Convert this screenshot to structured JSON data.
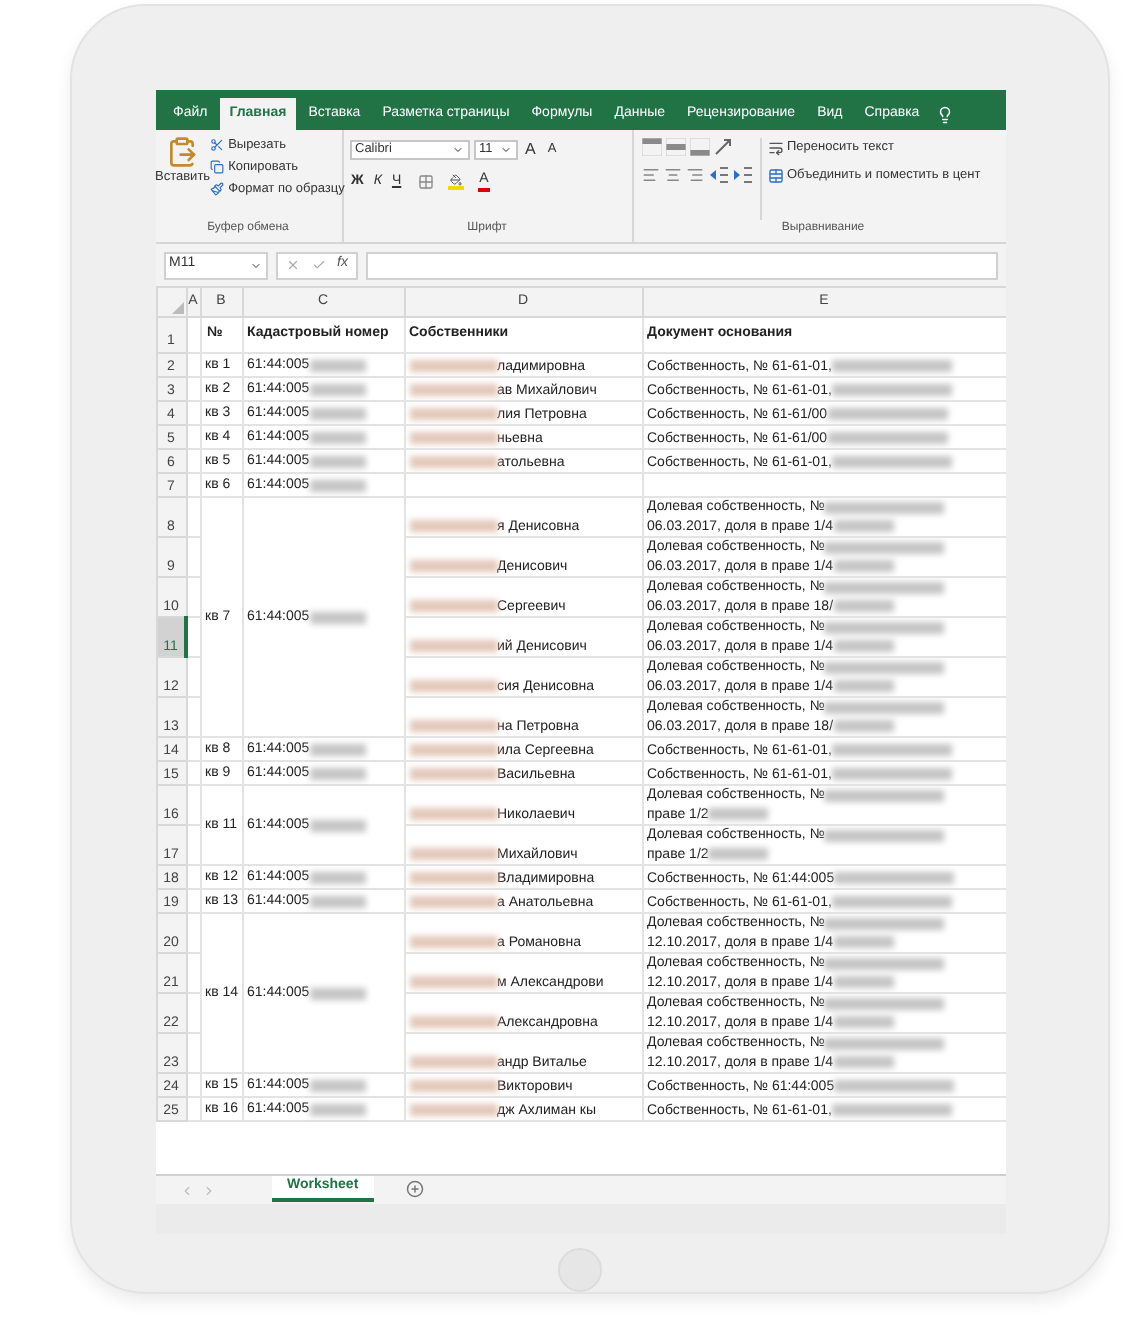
{
  "ribbon_tabs": [
    {
      "label": "Файл",
      "selected": false
    },
    {
      "label": "Главная",
      "selected": true
    },
    {
      "label": "Вставка",
      "selected": false
    },
    {
      "label": "Разметка страницы",
      "selected": false
    },
    {
      "label": "Формулы",
      "selected": false
    },
    {
      "label": "Данные",
      "selected": false
    },
    {
      "label": "Рецензирование",
      "selected": false
    },
    {
      "label": "Вид",
      "selected": false
    },
    {
      "label": "Справка",
      "selected": false
    }
  ],
  "clipboard": {
    "paste": "Вставить",
    "items": [
      {
        "kind": "cut",
        "label": "Вырезать"
      },
      {
        "kind": "copy",
        "label": "Копировать"
      },
      {
        "kind": "format",
        "label": "Формат по образцу"
      }
    ],
    "group_label": "Буфер обмена"
  },
  "font": {
    "family": "Calibri",
    "size": "11",
    "grow": "A",
    "shrink": "A",
    "bold": "Ж",
    "italic": "К",
    "underline": "Ч",
    "color_button": "A",
    "group_label": "Шрифт"
  },
  "alignment": {
    "wrap": "Переносить текст",
    "merge": "Объединить и поместить в цент",
    "group_label": "Выравнивание"
  },
  "formula_bar": {
    "name_box": "M11",
    "fx": "fx"
  },
  "columns": [
    "A",
    "B",
    "C",
    "D",
    "E"
  ],
  "header_row": {
    "row": "1",
    "no": "№",
    "cadastral": "Кадастровый номер",
    "owners": "Собственники",
    "document": "Документ основания"
  },
  "groups": [
    {
      "apt": "кв 1",
      "cadastral": "61:44:005",
      "rows": [
        {
          "row": "2",
          "selected": false,
          "owner": "ладимировна",
          "doc": [
            "Собственность, № 61-61-01,"
          ]
        }
      ]
    },
    {
      "apt": "кв 2",
      "cadastral": "61:44:005",
      "rows": [
        {
          "row": "3",
          "selected": false,
          "owner": "ав Михайлович",
          "doc": [
            "Собственность, № 61-61-01,"
          ]
        }
      ]
    },
    {
      "apt": "кв 3",
      "cadastral": "61:44:005",
      "rows": [
        {
          "row": "4",
          "selected": false,
          "owner": "лия Петровна",
          "doc": [
            "Собственность, № 61-61/00"
          ]
        }
      ]
    },
    {
      "apt": "кв 4",
      "cadastral": "61:44:005",
      "rows": [
        {
          "row": "5",
          "selected": false,
          "owner": "ньевна",
          "doc": [
            "Собственность, № 61-61/00"
          ]
        }
      ]
    },
    {
      "apt": "кв 5",
      "cadastral": "61:44:005",
      "rows": [
        {
          "row": "6",
          "selected": false,
          "owner": "атольевна",
          "doc": [
            "Собственность, № 61-61-01,"
          ]
        }
      ]
    },
    {
      "apt": "кв 6",
      "cadastral": "61:44:005",
      "rows": [
        {
          "row": "7",
          "selected": false
        }
      ]
    },
    {
      "apt": "кв 7",
      "cadastral": "61:44:005",
      "rows": [
        {
          "row": "8",
          "selected": false,
          "owner": "я Денисовна",
          "doc": [
            "Долевая собственность, №",
            "06.03.2017, доля в праве 1/4"
          ]
        },
        {
          "row": "9",
          "selected": false,
          "owner": "Денисович",
          "doc": [
            "Долевая собственность, №",
            "06.03.2017, доля в праве 1/4"
          ]
        },
        {
          "row": "10",
          "selected": false,
          "owner": "Сергеевич",
          "doc": [
            "Долевая собственность, №",
            "06.03.2017, доля в праве 18/"
          ]
        },
        {
          "row": "11",
          "selected": true,
          "owner": "ий Денисович",
          "doc": [
            "Долевая собственность, №",
            "06.03.2017, доля в праве 1/4"
          ]
        },
        {
          "row": "12",
          "selected": false,
          "owner": "сия Денисовна",
          "doc": [
            "Долевая собственность, №",
            "06.03.2017, доля в праве 1/4"
          ]
        },
        {
          "row": "13",
          "selected": false,
          "owner": "на Петровна",
          "doc": [
            "Долевая собственность, №",
            "06.03.2017, доля в праве 18/"
          ]
        }
      ]
    },
    {
      "apt": "кв 8",
      "cadastral": "61:44:005",
      "rows": [
        {
          "row": "14",
          "selected": false,
          "owner": "ила Сергеевна",
          "doc": [
            "Собственность, № 61-61-01,"
          ]
        }
      ]
    },
    {
      "apt": "кв 9",
      "cadastral": "61:44:005",
      "rows": [
        {
          "row": "15",
          "selected": false,
          "owner": "Васильевна",
          "doc": [
            "Собственность, № 61-61-01,"
          ]
        }
      ]
    },
    {
      "apt": "кв 11",
      "cadastral": "61:44:005",
      "rows": [
        {
          "row": "16",
          "selected": false,
          "owner": "Николаевич",
          "doc": [
            "Долевая собственность, №",
            "праве 1/2"
          ]
        },
        {
          "row": "17",
          "selected": false,
          "owner": "Михайлович",
          "doc": [
            "Долевая собственность, №",
            "праве 1/2"
          ]
        }
      ]
    },
    {
      "apt": "кв 12",
      "cadastral": "61:44:005",
      "rows": [
        {
          "row": "18",
          "selected": false,
          "owner": "Владимировна",
          "doc": [
            "Собственность, № 61:44:005"
          ]
        }
      ]
    },
    {
      "apt": "кв 13",
      "cadastral": "61:44:005",
      "rows": [
        {
          "row": "19",
          "selected": false,
          "owner": "а Анатольевна",
          "doc": [
            "Собственность, № 61-61-01,"
          ]
        }
      ]
    },
    {
      "apt": "кв 14",
      "cadastral": "61:44:005",
      "rows": [
        {
          "row": "20",
          "selected": false,
          "owner": "а Романовна",
          "doc": [
            "Долевая собственность, №",
            "12.10.2017, доля в праве 1/4"
          ]
        },
        {
          "row": "21",
          "selected": false,
          "owner": "м Александрови",
          "doc": [
            "Долевая собственность, №",
            "12.10.2017, доля в праве 1/4"
          ]
        },
        {
          "row": "22",
          "selected": false,
          "owner": "Александровна",
          "doc": [
            "Долевая собственность, №",
            "12.10.2017, доля в праве 1/4"
          ]
        },
        {
          "row": "23",
          "selected": false,
          "owner": "андр Виталье",
          "doc": [
            "Долевая собственность, №",
            "12.10.2017, доля в праве 1/4"
          ]
        }
      ]
    },
    {
      "apt": "кв 15",
      "cadastral": "61:44:005",
      "rows": [
        {
          "row": "24",
          "selected": false,
          "owner": "Викторович",
          "doc": [
            "Собственность, № 61:44:005"
          ]
        }
      ]
    },
    {
      "apt": "кв 16",
      "cadastral": "61:44:005",
      "rows": [
        {
          "row": "25",
          "selected": false,
          "owner": "дж Ахлиман кы",
          "doc": [
            "Собственность, № 61-61-01,"
          ]
        }
      ]
    }
  ],
  "sheet_tabs": [
    {
      "label": "Worksheet",
      "selected": true
    }
  ]
}
